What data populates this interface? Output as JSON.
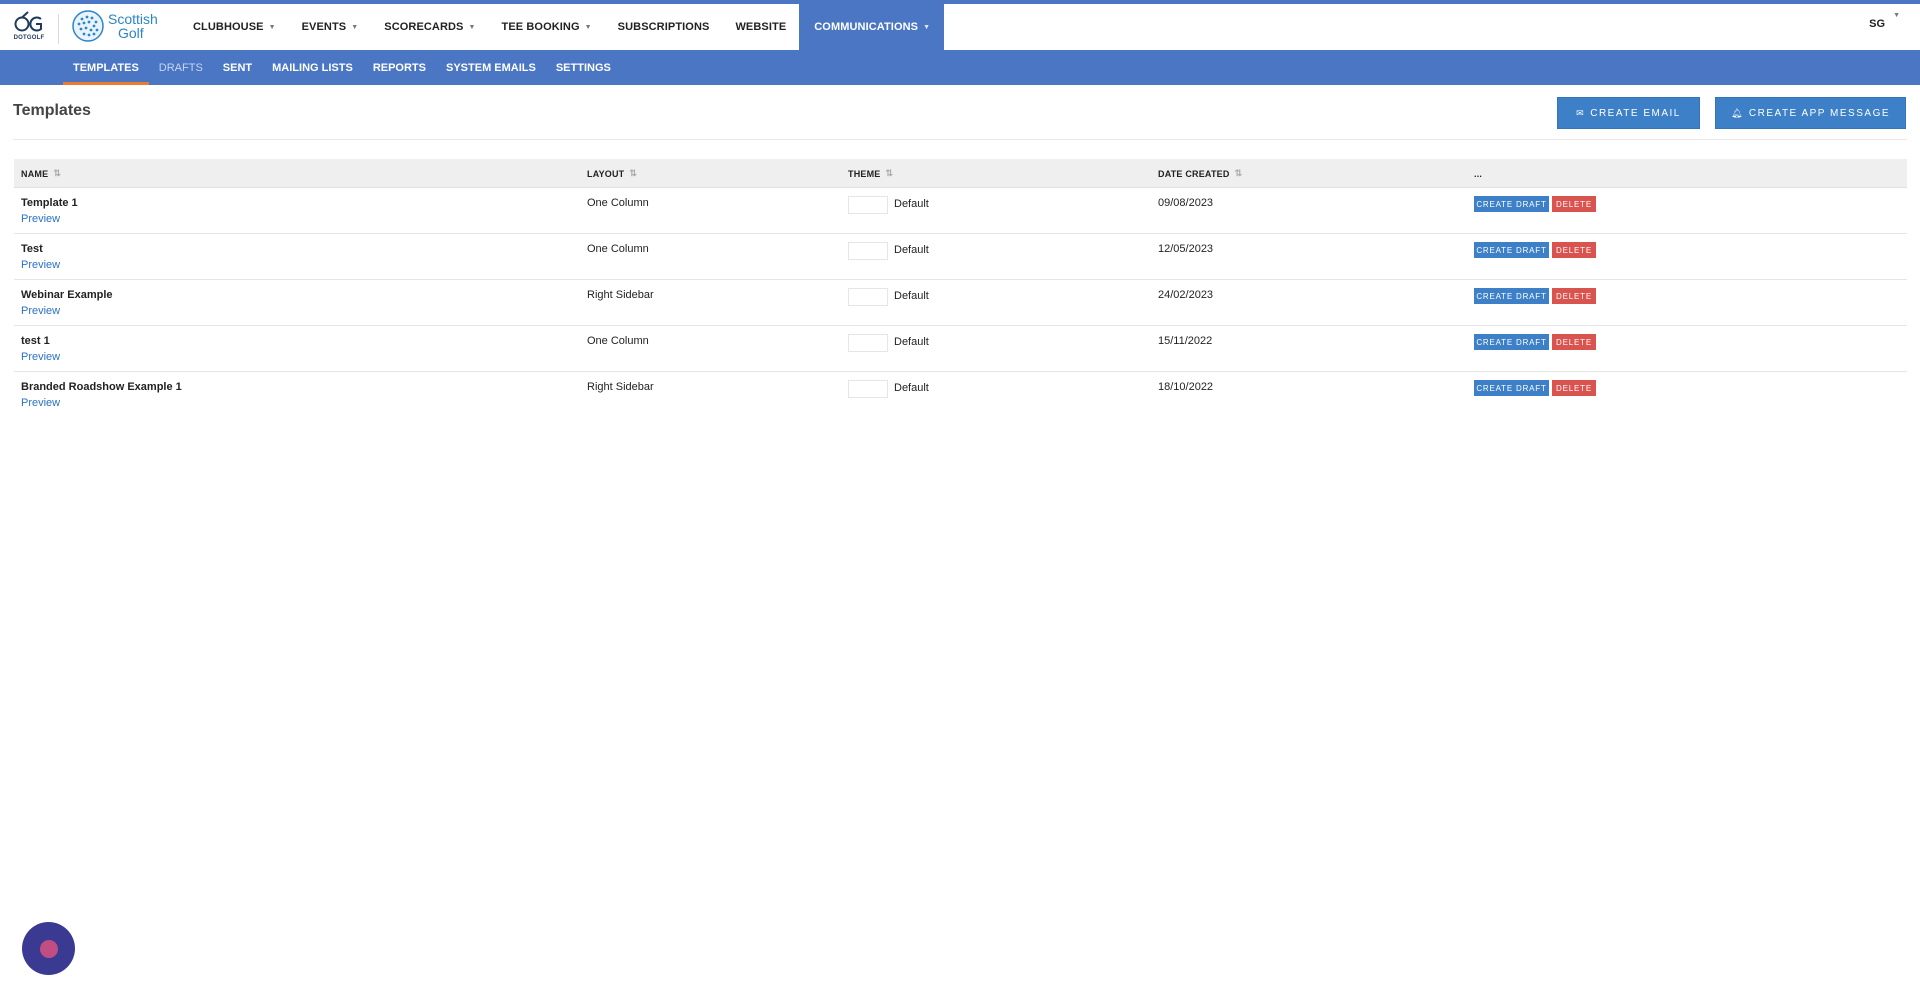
{
  "brand": {
    "dotgolf_label": "DOTGOLF",
    "scottish_golf_line1": "Scottish",
    "scottish_golf_line2": "Golf"
  },
  "main_nav": [
    {
      "label": "CLUBHOUSE",
      "has_dropdown": true,
      "active": false
    },
    {
      "label": "EVENTS",
      "has_dropdown": true,
      "active": false
    },
    {
      "label": "SCORECARDS",
      "has_dropdown": true,
      "active": false
    },
    {
      "label": "TEE BOOKING",
      "has_dropdown": true,
      "active": false
    },
    {
      "label": "SUBSCRIPTIONS",
      "has_dropdown": false,
      "active": false
    },
    {
      "label": "WEBSITE",
      "has_dropdown": false,
      "active": false
    },
    {
      "label": "COMMUNICATIONS",
      "has_dropdown": true,
      "active": true
    }
  ],
  "user_menu": {
    "initials": "SG"
  },
  "sub_nav": [
    {
      "label": "TEMPLATES",
      "active": true
    },
    {
      "label": "DRAFTS",
      "active": false
    },
    {
      "label": "SENT",
      "active": false
    },
    {
      "label": "MAILING LISTS",
      "active": false
    },
    {
      "label": "REPORTS",
      "active": false
    },
    {
      "label": "SYSTEM EMAILS",
      "active": false
    },
    {
      "label": "SETTINGS",
      "active": false
    }
  ],
  "page": {
    "title": "Templates",
    "create_email_label": "CREATE EMAIL",
    "create_app_message_label": "CREATE APP MESSAGE"
  },
  "table": {
    "columns": [
      "NAME",
      "LAYOUT",
      "THEME",
      "DATE CREATED",
      "..."
    ],
    "rows": [
      {
        "name": "Template 1",
        "preview": "Preview",
        "layout": "One Column",
        "theme": "Default",
        "date": "09/08/2023",
        "create_draft": "CREATE DRAFT",
        "delete": "DELETE"
      },
      {
        "name": "Test",
        "preview": "Preview",
        "layout": "One Column",
        "theme": "Default",
        "date": "12/05/2023",
        "create_draft": "CREATE DRAFT",
        "delete": "DELETE"
      },
      {
        "name": "Webinar Example",
        "preview": "Preview",
        "layout": "Right Sidebar",
        "theme": "Default",
        "date": "24/02/2023",
        "create_draft": "CREATE DRAFT",
        "delete": "DELETE"
      },
      {
        "name": "test 1",
        "preview": "Preview",
        "layout": "One Column",
        "theme": "Default",
        "date": "15/11/2022",
        "create_draft": "CREATE DRAFT",
        "delete": "DELETE"
      },
      {
        "name": "Branded Roadshow Example 1",
        "preview": "Preview",
        "layout": "Right Sidebar",
        "theme": "Default",
        "date": "18/10/2022",
        "create_draft": "CREATE DRAFT",
        "delete": "DELETE"
      }
    ]
  },
  "colors": {
    "nav_blue": "#4a76c3",
    "button_blue": "#3d80c8",
    "delete_red": "#d9534f",
    "active_underline": "#e97c2e",
    "chat_widget": "#3a3a93"
  },
  "icons": {
    "create_email": "envelope-icon",
    "create_app_message": "bell-icon",
    "sort": "sort-icon",
    "dropdown": "chevron-down-icon"
  }
}
